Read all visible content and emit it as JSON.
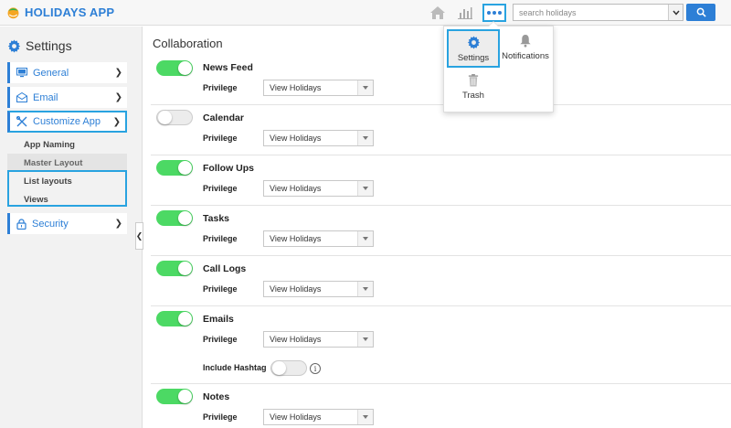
{
  "app": {
    "name": "HOLIDAYS APP"
  },
  "header": {
    "icons": [
      "home-icon",
      "bar-chart-icon",
      "more-icon"
    ],
    "search": {
      "placeholder": "search holidays",
      "value": ""
    }
  },
  "popover": {
    "items": [
      {
        "label": "Settings",
        "icon": "gear-icon",
        "active": true
      },
      {
        "label": "Notifications",
        "icon": "bell-icon",
        "active": false
      },
      {
        "label": "Trash",
        "icon": "trash-icon",
        "active": false
      }
    ]
  },
  "sidebar": {
    "title": "Settings",
    "items": [
      {
        "label": "General",
        "icon": "monitor-icon"
      },
      {
        "label": "Email",
        "icon": "envelope-icon"
      },
      {
        "label": "Customize App",
        "icon": "tools-icon"
      },
      {
        "label": "Security",
        "icon": "lock-icon"
      }
    ],
    "sub_items": [
      {
        "label": "App Naming"
      },
      {
        "label": "Master Layout"
      },
      {
        "label": "List layouts"
      },
      {
        "label": "Views"
      }
    ]
  },
  "main": {
    "section_title": "Collaboration",
    "privilege_label": "Privilege",
    "modules": [
      {
        "name": "News Feed",
        "enabled": true,
        "privilege": "View Holidays"
      },
      {
        "name": "Calendar",
        "enabled": false,
        "privilege": "View Holidays"
      },
      {
        "name": "Follow Ups",
        "enabled": true,
        "privilege": "View Holidays"
      },
      {
        "name": "Tasks",
        "enabled": true,
        "privilege": "View Holidays"
      },
      {
        "name": "Call Logs",
        "enabled": true,
        "privilege": "View Holidays"
      },
      {
        "name": "Emails",
        "enabled": true,
        "privilege": "View Holidays"
      },
      {
        "name": "Notes",
        "enabled": true,
        "privilege": "View Holidays"
      }
    ],
    "include_hashtag": {
      "label": "Include Hashtag",
      "enabled": false
    }
  },
  "colors": {
    "accent": "#2d7fd6",
    "highlight_border": "#29a3e0",
    "toggle_on": "#4cd964"
  }
}
